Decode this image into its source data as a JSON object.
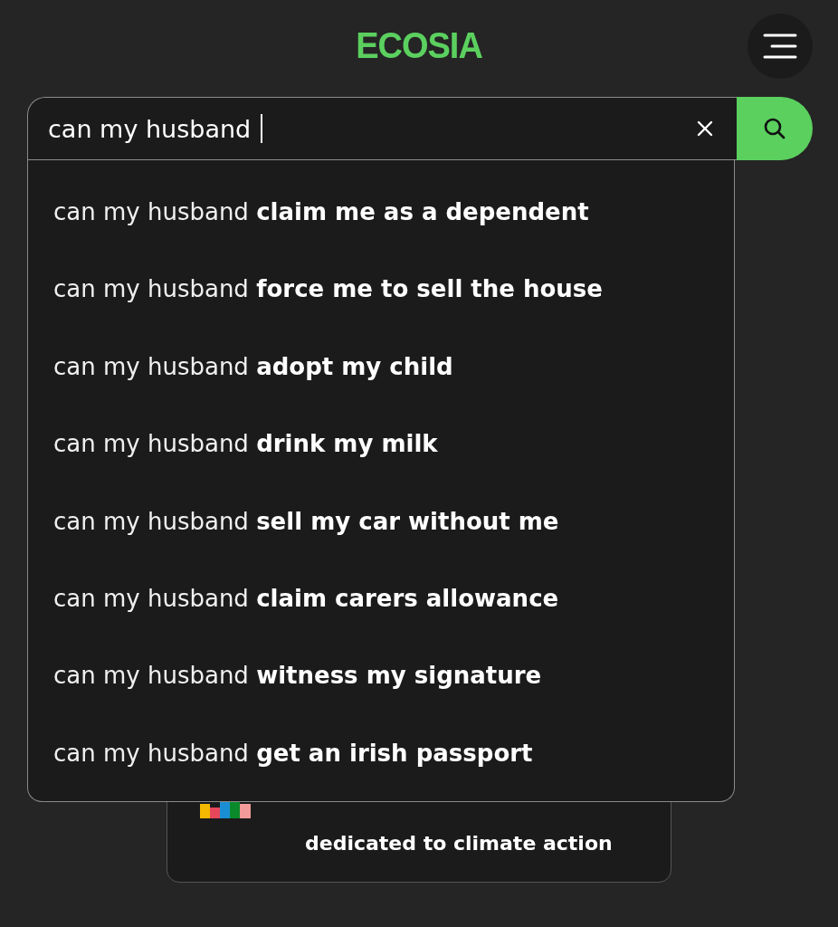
{
  "header": {
    "logo": "ECOSIA"
  },
  "search": {
    "value": "can my husband",
    "focused": true
  },
  "suggestions": [
    {
      "text": "can my husband **claim me as a dependent**"
    },
    {
      "text": "can my husband **force me to sell the house**"
    },
    {
      "text": "can my husband **adopt my child**"
    },
    {
      "text": "can my husband **drink my milk**"
    },
    {
      "text": "can my husband **sell my car without me**"
    },
    {
      "text": "can my husband **claim carers allowance**"
    },
    {
      "text": "can my husband **witness my signature**"
    },
    {
      "text": "can my husband **get an irish passport**"
    }
  ],
  "counter_card": {
    "caption": "dedicated to climate action"
  }
}
